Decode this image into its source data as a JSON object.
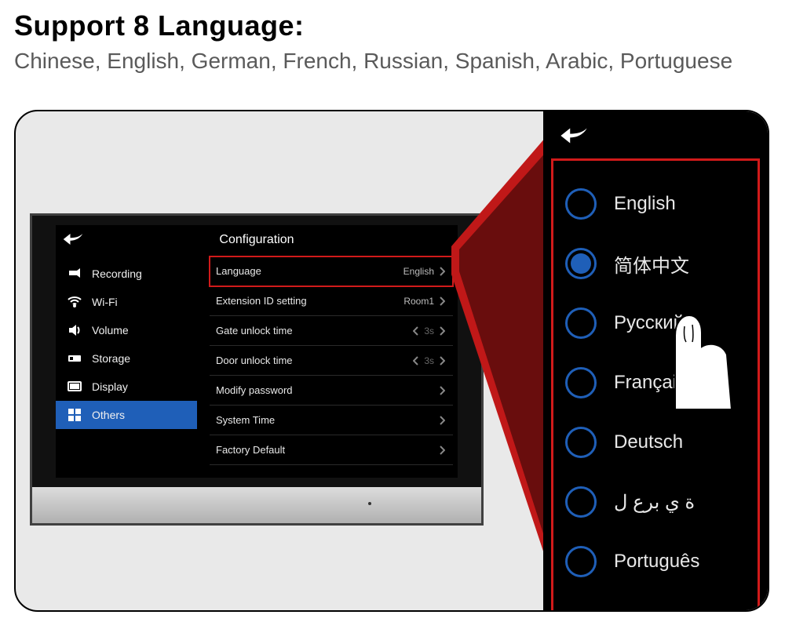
{
  "header": {
    "title": "Support 8 Language:",
    "subtitle": "Chinese, English, German, French, Russian, Spanish, Arabic, Portuguese"
  },
  "screen": {
    "title": "Configuration",
    "sidebar": [
      {
        "icon": "camera",
        "label": "Recording",
        "active": false
      },
      {
        "icon": "wifi",
        "label": "Wi-Fi",
        "active": false
      },
      {
        "icon": "volume",
        "label": "Volume",
        "active": false
      },
      {
        "icon": "storage",
        "label": "Storage",
        "active": false
      },
      {
        "icon": "display",
        "label": "Display",
        "active": false
      },
      {
        "icon": "others",
        "label": "Others",
        "active": true
      }
    ],
    "settings": [
      {
        "label": "Language",
        "value": "English",
        "highlight": true,
        "hasLeft": false,
        "hasRight": true,
        "dim": false
      },
      {
        "label": "Extension ID setting",
        "value": "Room1",
        "highlight": false,
        "hasLeft": false,
        "hasRight": true,
        "dim": false
      },
      {
        "label": "Gate unlock time",
        "value": "3s",
        "highlight": false,
        "hasLeft": true,
        "hasRight": true,
        "dim": true
      },
      {
        "label": "Door unlock time",
        "value": "3s",
        "highlight": false,
        "hasLeft": true,
        "hasRight": true,
        "dim": true
      },
      {
        "label": "Modify  password",
        "value": "",
        "highlight": false,
        "hasLeft": false,
        "hasRight": true,
        "dim": false
      },
      {
        "label": "System Time",
        "value": "",
        "highlight": false,
        "hasLeft": false,
        "hasRight": true,
        "dim": false
      },
      {
        "label": "Factory Default",
        "value": "",
        "highlight": false,
        "hasLeft": false,
        "hasRight": true,
        "dim": false
      }
    ]
  },
  "languages": [
    {
      "label": "English",
      "selected": false
    },
    {
      "label": "简体中文",
      "selected": true
    },
    {
      "label": "Русский",
      "selected": false
    },
    {
      "label": "Français",
      "selected": false
    },
    {
      "label": "Deutsch",
      "selected": false
    },
    {
      "label": "ة ي برع ل",
      "selected": false
    },
    {
      "label": "Português",
      "selected": false
    }
  ]
}
